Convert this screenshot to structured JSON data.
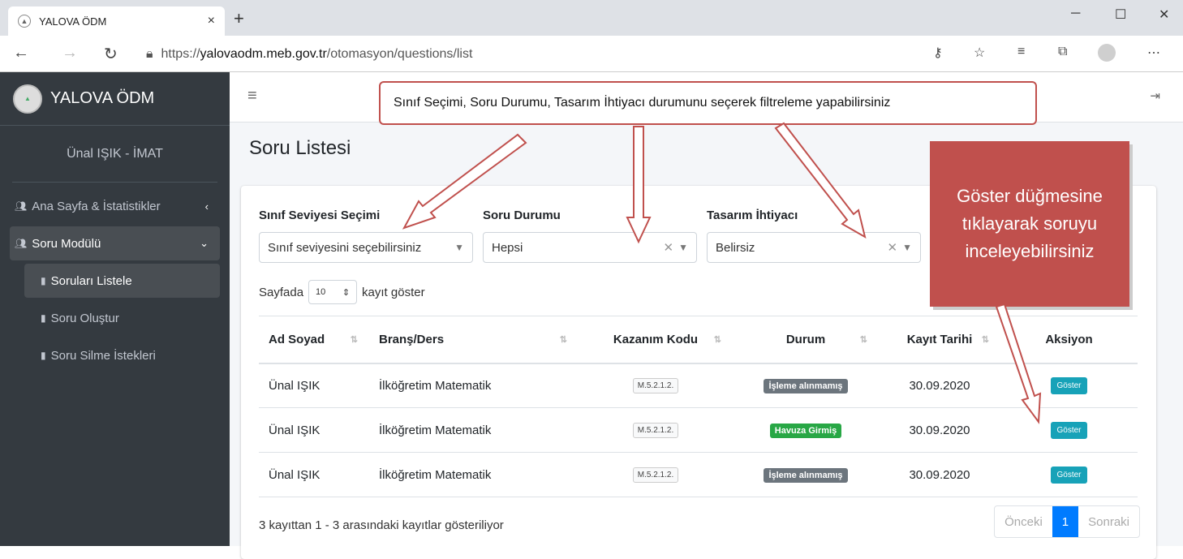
{
  "browser": {
    "tab_title": "YALOVA ÖDM",
    "tab_close": "×",
    "new_tab": "+",
    "url_prefix": "https://",
    "url_host": "yalovaodm.meb.gov.tr",
    "url_path": "/otomasyon/questions/list"
  },
  "sidebar": {
    "brand": "YALOVA ÖDM",
    "user": "Ünal IŞIK - İMAT",
    "items": [
      {
        "label": "Ana Sayfa & İstatistikler",
        "icon": "users-icon"
      },
      {
        "label": "Soru Modülü",
        "icon": "users-icon"
      },
      {
        "label": "Soruları Listele",
        "icon": "book-icon"
      },
      {
        "label": "Soru Oluştur",
        "icon": "save-icon"
      },
      {
        "label": "Soru Silme İstekleri",
        "icon": "trash-icon"
      }
    ]
  },
  "page": {
    "title": "Soru Listesi"
  },
  "filters": {
    "class_label": "Sınıf Seviyesi Seçimi",
    "class_value": "Sınıf seviyesini seçebilirsiniz",
    "status_label": "Soru Durumu",
    "status_value": "Hepsi",
    "design_label": "Tasarım İhtiyacı",
    "design_value": "Belirsiz"
  },
  "length": {
    "prefix": "Sayfada",
    "value": "10",
    "suffix": "kayıt göster"
  },
  "table": {
    "headers": [
      "Ad Soyad",
      "Branş/Ders",
      "Kazanım Kodu",
      "Durum",
      "Kayıt Tarihi",
      "Aksiyon"
    ],
    "rows": [
      {
        "name": "Ünal IŞIK",
        "branch": "İlköğretim Matematik",
        "code": "M.5.2.1.2.",
        "status": "İşleme alınmamış",
        "date": "30.09.2020",
        "action": "Göster"
      },
      {
        "name": "Ünal IŞIK",
        "branch": "İlköğretim Matematik",
        "code": "M.5.2.1.2.",
        "status": "Havuza Girmiş",
        "date": "30.09.2020",
        "action": "Göster"
      },
      {
        "name": "Ünal IŞIK",
        "branch": "İlköğretim Matematik",
        "code": "M.5.2.1.2.",
        "status": "İşleme alınmamış",
        "date": "30.09.2020",
        "action": "Göster"
      }
    ]
  },
  "footer": {
    "info": "3 kayıttan 1 - 3 arasındaki kayıtlar gösteriliyor",
    "prev": "Önceki",
    "page": "1",
    "next": "Sonraki"
  },
  "annotations": {
    "filter_note": "Sınıf Seçimi, Soru Durumu, Tasarım İhtiyacı durumunu seçerek filtreleme yapabilirsiniz",
    "show_note": "Göster düğmesine tıklayarak soruyu inceleyebilirsiniz"
  },
  "colors": {
    "sidebar": "#343a40",
    "accent": "#007bff",
    "info_button": "#17a2b8",
    "success": "#28a745",
    "annotation": "#c0504d"
  }
}
